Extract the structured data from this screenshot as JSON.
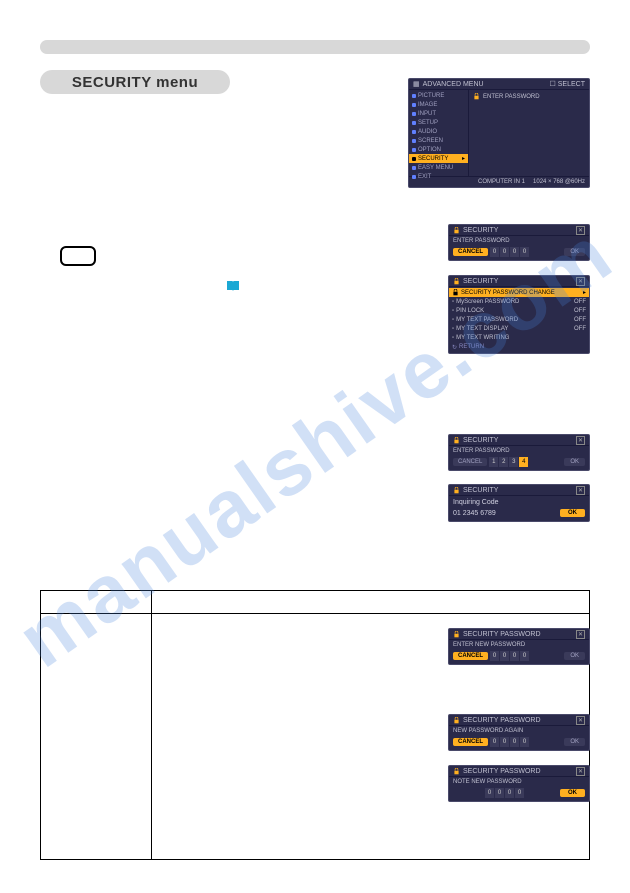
{
  "section_title": "SECURITY menu",
  "advanced_menu": {
    "header": "ADVANCED MENU",
    "header_right": "SELECT",
    "sidebar": [
      {
        "label": "PICTURE"
      },
      {
        "label": "IMAGE"
      },
      {
        "label": "INPUT"
      },
      {
        "label": "SETUP"
      },
      {
        "label": "AUDIO"
      },
      {
        "label": "SCREEN"
      },
      {
        "label": "OPTION"
      },
      {
        "label": "SECURITY",
        "selected": true
      },
      {
        "label": "EASY MENU"
      },
      {
        "label": "EXIT"
      }
    ],
    "content_row": "ENTER PASSWORD",
    "footer_left": "COMPUTER IN 1",
    "footer_right": "1024 × 768 @60Hz"
  },
  "security_enter": {
    "header": "SECURITY",
    "label": "ENTER PASSWORD",
    "cancel": "CANCEL",
    "digits": [
      "0",
      "0",
      "0",
      "0"
    ],
    "ok": "OK"
  },
  "security_menu": {
    "header": "SECURITY",
    "items": [
      {
        "label": "SECURITY PASSWORD CHANGE",
        "selected": true
      },
      {
        "label": "MyScreen PASSWORD",
        "value": "OFF"
      },
      {
        "label": "PIN LOCK",
        "value": "OFF"
      },
      {
        "label": "MY TEXT PASSWORD",
        "value": "OFF"
      },
      {
        "label": "MY TEXT DISPLAY",
        "value": "OFF"
      },
      {
        "label": "MY TEXT WRITING"
      }
    ],
    "return": "RETURN"
  },
  "security_enter2": {
    "header": "SECURITY",
    "label": "ENTER PASSWORD",
    "cancel": "CANCEL",
    "digits": [
      "1",
      "2",
      "3",
      "4"
    ],
    "ok": "OK"
  },
  "inquiring": {
    "header": "SECURITY",
    "label": "Inquiring Code",
    "code": "01 2345 6789",
    "ok": "OK"
  },
  "sec_pwd_new": {
    "header": "SECURITY PASSWORD",
    "label": "ENTER NEW PASSWORD",
    "cancel": "CANCEL",
    "digits": [
      "0",
      "0",
      "0",
      "0"
    ],
    "ok": "OK"
  },
  "sec_pwd_again": {
    "header": "SECURITY PASSWORD",
    "label": "NEW PASSWORD AGAIN",
    "cancel": "CANCEL",
    "digits": [
      "0",
      "0",
      "0",
      "0"
    ],
    "ok": "OK"
  },
  "sec_pwd_note": {
    "header": "SECURITY PASSWORD",
    "label": "NOTE NEW PASSWORD",
    "digits": [
      "0",
      "0",
      "0",
      "0"
    ],
    "ok": "OK"
  },
  "watermark": "manualshive.com"
}
